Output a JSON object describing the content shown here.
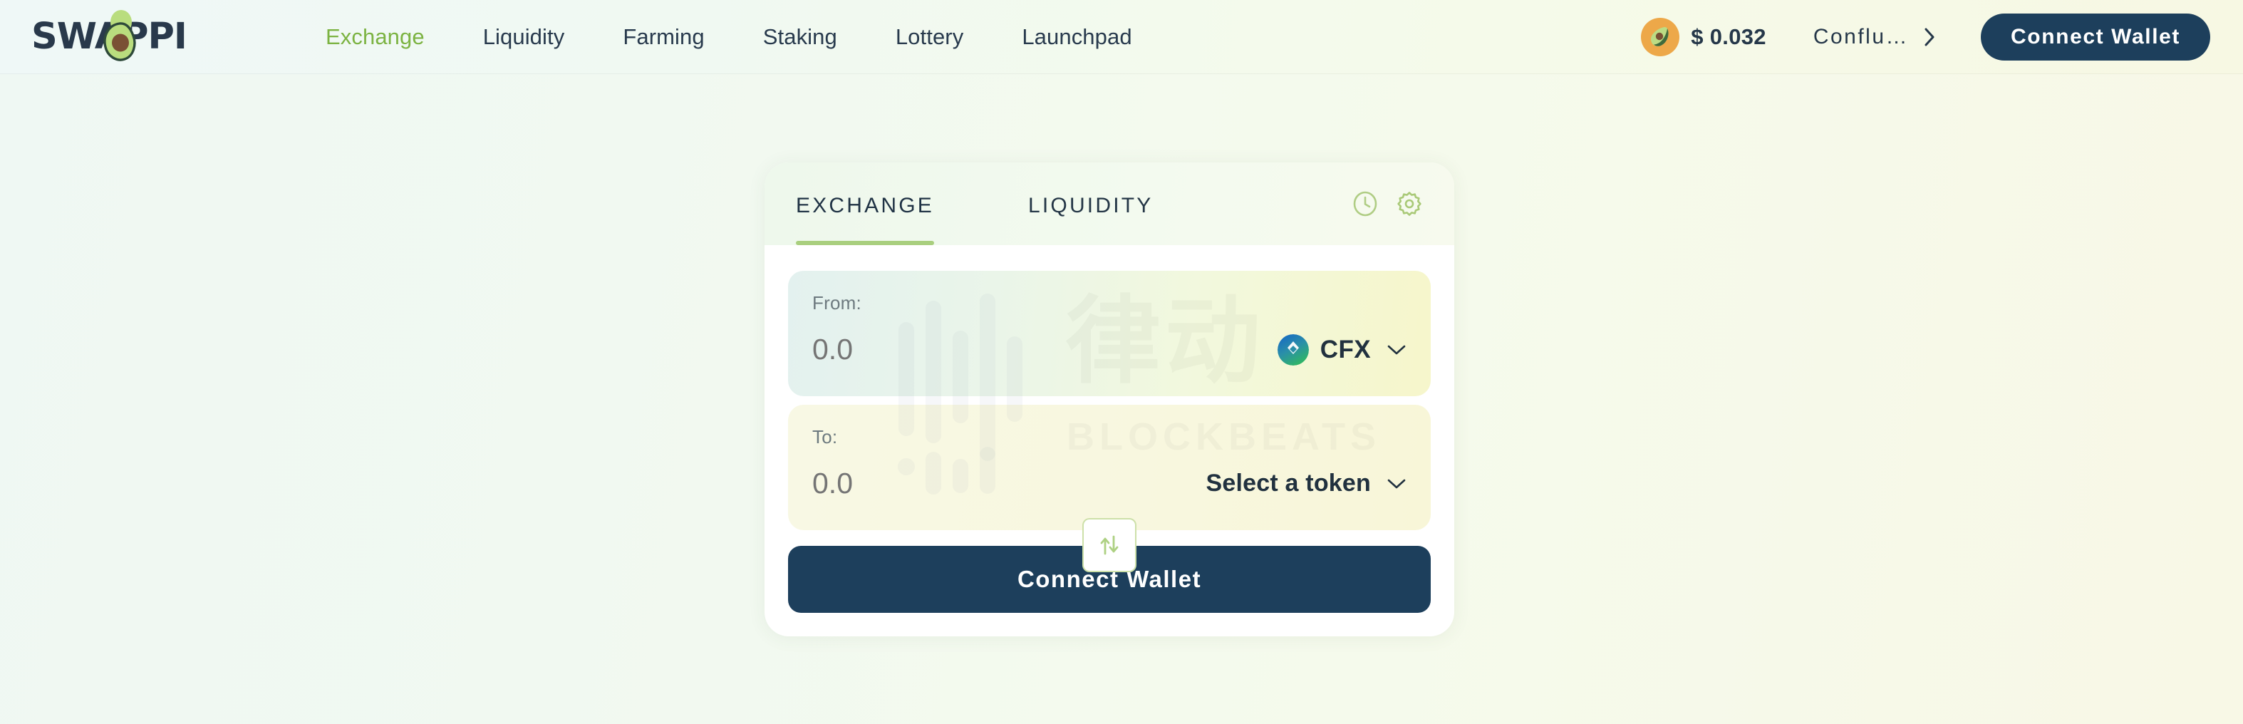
{
  "brand": {
    "name": "SWAPPI",
    "logo_icon": "avocado-icon",
    "text_color": "#29394b",
    "accent_color": "#7cb342"
  },
  "header": {
    "nav": [
      {
        "label": "Exchange",
        "active": true
      },
      {
        "label": "Liquidity",
        "active": false
      },
      {
        "label": "Farming",
        "active": false
      },
      {
        "label": "Staking",
        "active": false
      },
      {
        "label": "Lottery",
        "active": false
      },
      {
        "label": "Launchpad",
        "active": false
      }
    ],
    "price_badge": {
      "icon": "avocado-token-icon",
      "value": "$ 0.032"
    },
    "network": {
      "label": "Conflu…",
      "chevron_icon": "chevron-right-icon"
    },
    "connect_wallet_label": "Connect Wallet",
    "connect_wallet_color": "#1d3f5c"
  },
  "swap_card": {
    "tabs": [
      {
        "label": "EXCHANGE",
        "active": true
      },
      {
        "label": "LIQUIDITY",
        "active": false
      }
    ],
    "tab_icons": [
      {
        "name": "history-clock-icon"
      },
      {
        "name": "settings-gear-icon"
      }
    ],
    "from": {
      "label": "From:",
      "amount_value": "0.0",
      "amount_placeholder": "0.0",
      "token_symbol": "CFX",
      "token_icon": "cfx-token-icon",
      "chevron_icon": "chevron-down-icon"
    },
    "swap_toggle": {
      "icon": "swap-vertical-arrows-icon"
    },
    "to": {
      "label": "To:",
      "amount_value": "0.0",
      "amount_placeholder": "0.0",
      "token_placeholder": "Select a token",
      "chevron_icon": "chevron-down-icon"
    },
    "action_label": "Connect Wallet"
  },
  "watermark": {
    "cn_text": "律动",
    "en_text": "BLOCKBEATS"
  }
}
